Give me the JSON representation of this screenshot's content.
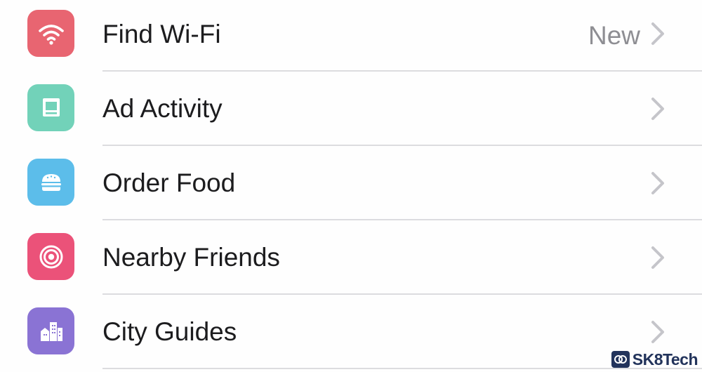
{
  "menu": {
    "items": [
      {
        "label": "Find Wi-Fi",
        "detail": "New",
        "icon": "wifi-icon",
        "color": "#e86571"
      },
      {
        "label": "Ad Activity",
        "detail": "",
        "icon": "monitor-icon",
        "color": "#72d2b9"
      },
      {
        "label": "Order Food",
        "detail": "",
        "icon": "burger-icon",
        "color": "#5cbdea"
      },
      {
        "label": "Nearby Friends",
        "detail": "",
        "icon": "target-icon",
        "color": "#eb5279"
      },
      {
        "label": "City Guides",
        "detail": "",
        "icon": "city-buildings-icon",
        "color": "#8a73d4"
      }
    ]
  },
  "watermark": {
    "text": "SK8Tech",
    "color": "#22335b"
  }
}
